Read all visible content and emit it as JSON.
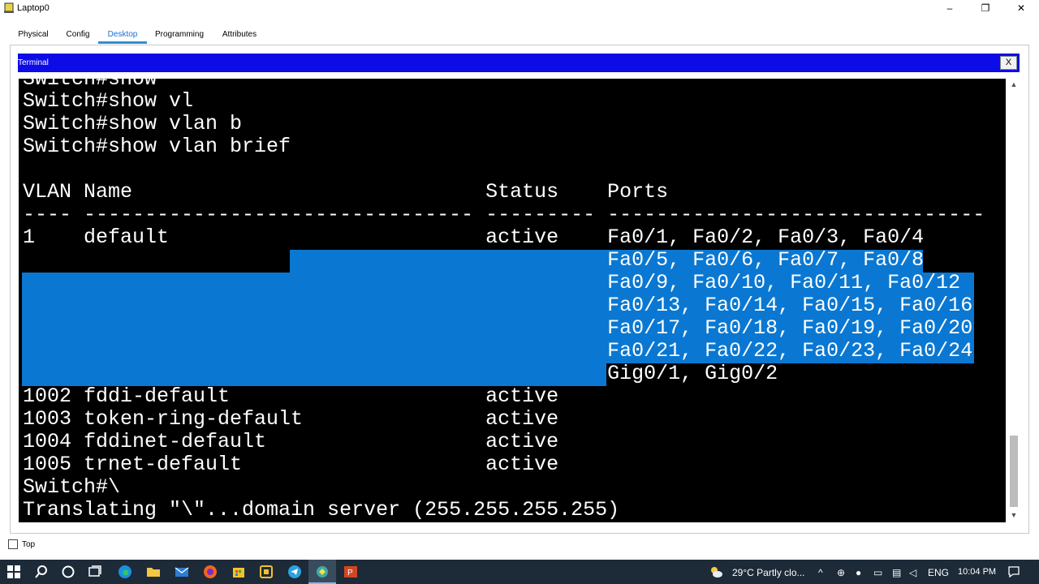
{
  "window": {
    "title": "Laptop0",
    "minimize": "–",
    "restore": "❐",
    "close": "✕"
  },
  "tabs": [
    {
      "label": "Physical"
    },
    {
      "label": "Config"
    },
    {
      "label": "Desktop"
    },
    {
      "label": "Programming"
    },
    {
      "label": "Attributes"
    }
  ],
  "active_tab": "Desktop",
  "terminal": {
    "title": "Terminal",
    "close_label": "X",
    "lines": [
      "Switch#show",
      "Switch#show vl",
      "Switch#show vlan b",
      "Switch#show vlan brief",
      "",
      "VLAN Name                             Status    Ports",
      "---- -------------------------------- --------- -------------------------------",
      "1    default                          active    Fa0/1, Fa0/2, Fa0/3, Fa0/4",
      "                                                Fa0/5, Fa0/6, Fa0/7, Fa0/8",
      "                                                Fa0/9, Fa0/10, Fa0/11, Fa0/12",
      "                                                Fa0/13, Fa0/14, Fa0/15, Fa0/16",
      "                                                Fa0/17, Fa0/18, Fa0/19, Fa0/20",
      "                                                Fa0/21, Fa0/22, Fa0/23, Fa0/24",
      "                                                Gig0/1, Gig0/2",
      "1002 fddi-default                     active",
      "1003 token-ring-default               active",
      "1004 fddinet-default                  active",
      "1005 trnet-default                    active",
      "Switch#\\",
      "Translating \"\\\"...domain server (255.255.255.255)"
    ]
  },
  "footer": {
    "top_label": "Top"
  },
  "taskbar": {
    "weather": "29°C  Partly clo...",
    "language": "ENG",
    "time": "10:04 PM"
  },
  "colors": {
    "terminal_header": "#0d0be6",
    "selection": "#0a78d2",
    "active_tab": "#1a6fd0",
    "taskbar": "#1d2a38"
  }
}
